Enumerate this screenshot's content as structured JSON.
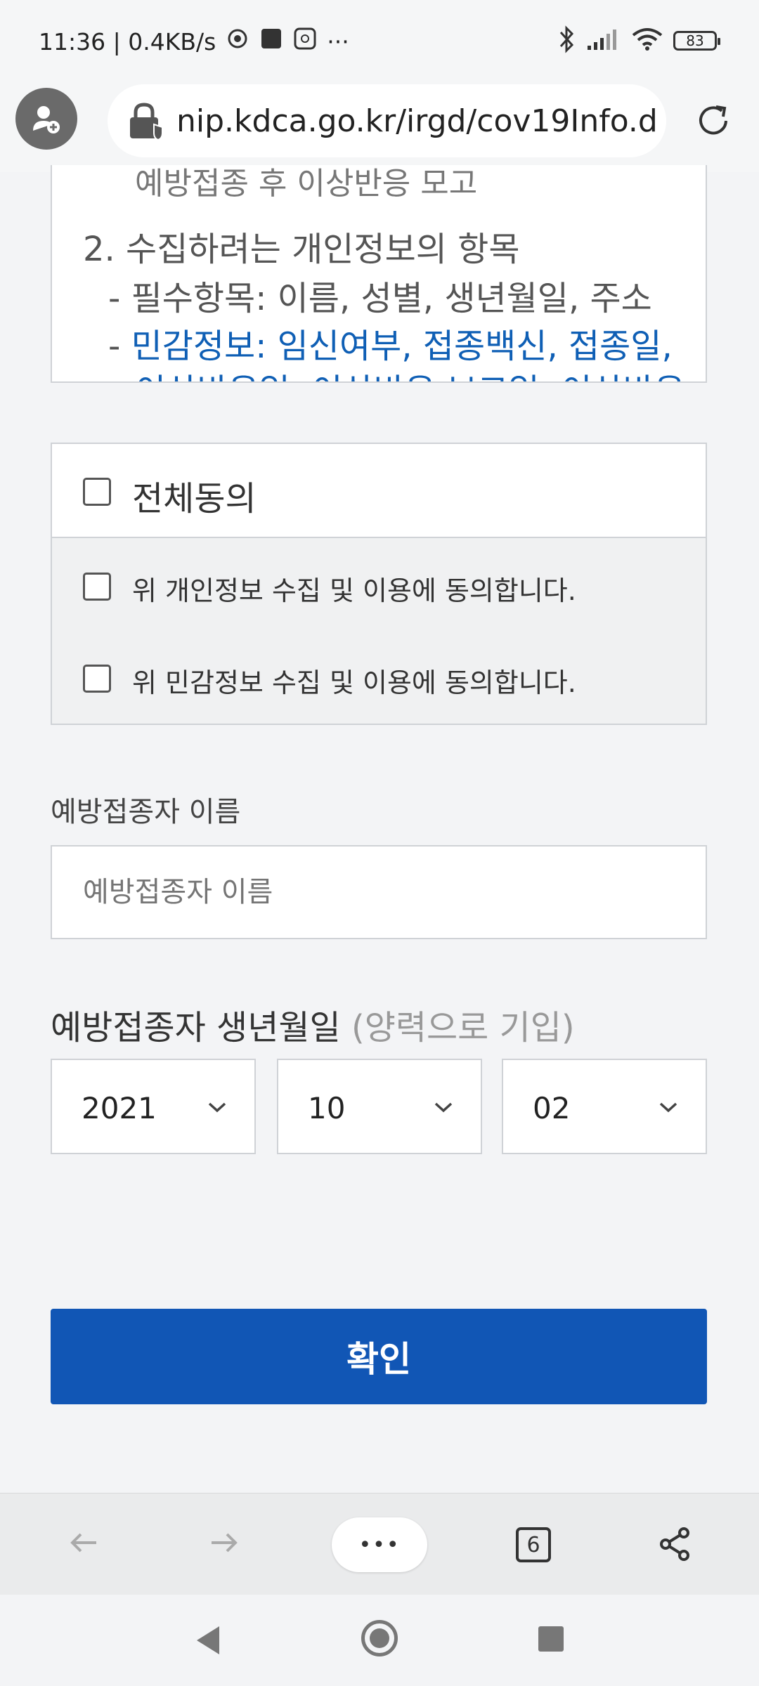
{
  "status_bar": {
    "time": "11:36",
    "speed": "0.4KB/s",
    "more": "···",
    "battery": "83"
  },
  "browser": {
    "url": "nip.kdca.go.kr/irgd/cov19Info.d",
    "tab_count": "6",
    "menu_dots": "•••"
  },
  "info_box": {
    "cut_line": "예방접종 후 이상반응 모고",
    "section_title": "2. 수집하려는 개인정보의 항목",
    "required_items": "- 필수항목: 이름, 성별, 생년월일, 주소",
    "sensitive_dash": "- ",
    "sensitive_items": "민감정보: 임신여부, 접종백신, 접종일,",
    "sensitive_cut": "이상반응일, 이상반응 보고일, 이상반응"
  },
  "consent": {
    "all": "전체동의",
    "personal": "위 개인정보 수집 및 이용에 동의합니다.",
    "sensitive": "위 민감정보 수집 및 이용에 동의합니다."
  },
  "form": {
    "name_label": "예방접종자 이름",
    "name_placeholder": "예방접종자 이름",
    "dob_label": "예방접종자 생년월일",
    "dob_hint": "(양력으로 기입)",
    "year": "2021",
    "month": "10",
    "day": "02",
    "confirm": "확인"
  },
  "colors": {
    "primary": "#1156b5",
    "sensitive_text": "#0f5fb5"
  }
}
